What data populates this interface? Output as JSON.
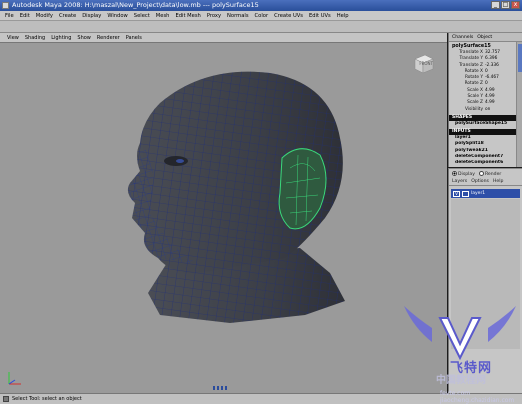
{
  "window": {
    "title": "Autodesk Maya 2008: H:\\maszal\\New_Project\\data\\low.mb   ---   polySurface15",
    "min": "_",
    "max": "□",
    "close": "x"
  },
  "menubar": [
    "File",
    "Edit",
    "Modify",
    "Create",
    "Display",
    "Window",
    "Select",
    "Mesh",
    "Edit Mesh",
    "Proxy",
    "Normals",
    "Color",
    "Create UVs",
    "Edit UVs",
    "Help"
  ],
  "panel_menu": [
    "View",
    "Shading",
    "Lighting",
    "Show",
    "Renderer",
    "Panels"
  ],
  "channel_box": {
    "tabs": [
      "Channels",
      "Object"
    ],
    "object_name": "polySurface15",
    "attributes": [
      {
        "name": "Translate X",
        "value": "32.757"
      },
      {
        "name": "Translate Y",
        "value": "6.396"
      },
      {
        "name": "Translate Z",
        "value": "-2.336"
      },
      {
        "name": "Rotate X",
        "value": "0"
      },
      {
        "name": "Rotate Y",
        "value": "-6.467"
      },
      {
        "name": "Rotate Z",
        "value": "0"
      },
      {
        "name": "Scale X",
        "value": "4.99"
      },
      {
        "name": "Scale Y",
        "value": "4.99"
      },
      {
        "name": "Scale Z",
        "value": "4.99"
      },
      {
        "name": "Visibility",
        "value": "on"
      }
    ],
    "shapes_label": "SHAPES",
    "shape_item": "polySurfaceShape15",
    "inputs_label": "INPUTS",
    "inputs": [
      "layer1",
      "polySplit18",
      "polyTweak21",
      "deleteComponent7",
      "deleteComponent6"
    ]
  },
  "layer_editor": {
    "radio_display": "Display",
    "radio_render": "Render",
    "menu": [
      "Layers",
      "Options",
      "Help"
    ],
    "layer": {
      "visibility": "V",
      "name": "layer1"
    }
  },
  "viewcube_label": "FRONT",
  "status": {
    "text": "Select Tool: select an object"
  },
  "watermark": {
    "line1": "飞特网",
    "line2": "中国教程网",
    "line3": "fevte.com  jiaocheng.chazidian.com"
  },
  "colors": {
    "viewport_bg": "#9a9a9a",
    "mesh": "#3a3d44",
    "wire": "#1f2e7a",
    "selection": "#3ad87a",
    "layer_highlight": "#2e4fa8"
  }
}
